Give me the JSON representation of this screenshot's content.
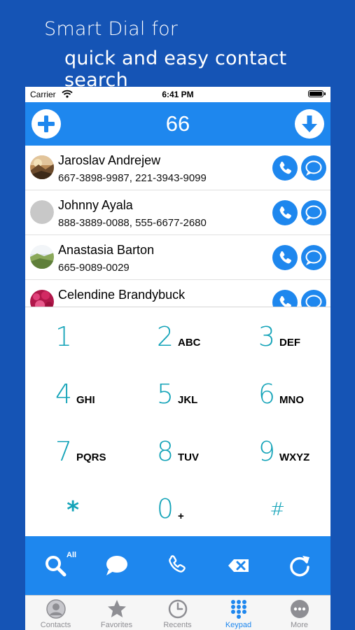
{
  "promo": {
    "line1": "Smart Dial for",
    "line2": "quick and easy contact search"
  },
  "status_bar": {
    "carrier": "Carrier",
    "time": "6:41 PM"
  },
  "navbar": {
    "add_icon": "plus-circle-icon",
    "dialed_number": "66",
    "collapse_icon": "arrow-down-circle-icon",
    "accent_color": "#1e87ee"
  },
  "contacts": [
    {
      "name": "Jaroslav Andrejew",
      "phones": "667-3898-9987, 221-3943-9099",
      "avatar": "photo"
    },
    {
      "name": "Johnny Ayala",
      "phones": "888-3889-0088, 555-6677-2680",
      "avatar": "placeholder"
    },
    {
      "name": "Anastasia Barton",
      "phones": "665-9089-0029",
      "avatar": "photo"
    },
    {
      "name": "Celendine Brandybuck",
      "phones": "",
      "avatar": "photo"
    }
  ],
  "keypad": {
    "digit_color": "#13a3b8",
    "keys": [
      {
        "digit": "1",
        "letters": ""
      },
      {
        "digit": "2",
        "letters": "ABC"
      },
      {
        "digit": "3",
        "letters": "DEF"
      },
      {
        "digit": "4",
        "letters": "GHI"
      },
      {
        "digit": "5",
        "letters": "JKL"
      },
      {
        "digit": "6",
        "letters": "MNO"
      },
      {
        "digit": "7",
        "letters": "PQRS"
      },
      {
        "digit": "8",
        "letters": "TUV"
      },
      {
        "digit": "9",
        "letters": "WXYZ"
      },
      {
        "digit": "*",
        "letters": ""
      },
      {
        "digit": "0",
        "letters": "+"
      },
      {
        "digit": "#",
        "letters": ""
      }
    ]
  },
  "toolbar": {
    "search_scope_badge": "All",
    "icons": [
      "search-icon",
      "message-icon",
      "phone-icon",
      "backspace-icon",
      "refresh-icon"
    ]
  },
  "tabs": [
    {
      "label": "Contacts",
      "icon": "person-circle-icon",
      "active": false
    },
    {
      "label": "Favorites",
      "icon": "star-icon",
      "active": false
    },
    {
      "label": "Recents",
      "icon": "clock-icon",
      "active": false
    },
    {
      "label": "Keypad",
      "icon": "keypad-icon",
      "active": true
    },
    {
      "label": "More",
      "icon": "more-icon",
      "active": false
    }
  ]
}
